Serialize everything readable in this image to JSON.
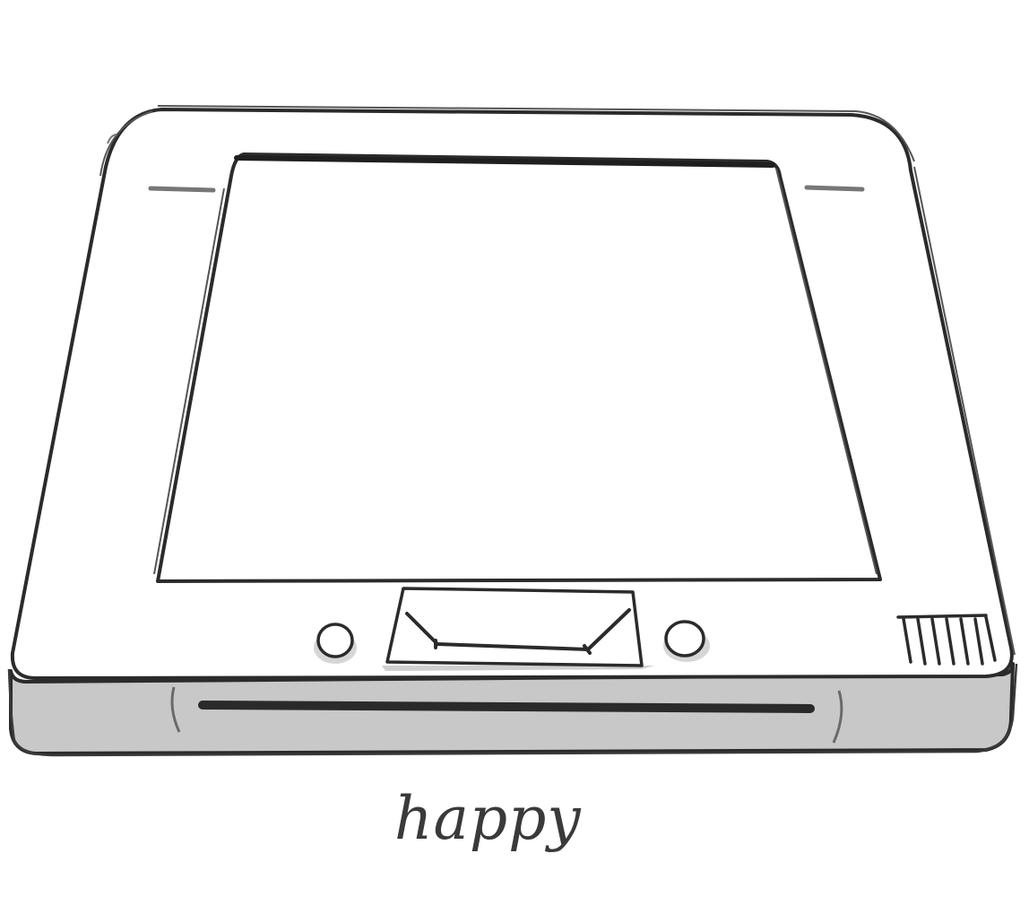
{
  "caption": "happy",
  "colors": {
    "ink": "#2b2b2b",
    "ink_light": "#4a4a4a",
    "body_fill": "#ffffff",
    "front_fill": "#c8c8c8",
    "shadow": "#d6d6d6"
  },
  "icons": {
    "device": "scanner-device-icon",
    "left_button": "round-button-icon",
    "right_button": "round-button-icon",
    "center_panel": "envelope-panel-icon",
    "vent": "vent-grille-icon",
    "slot": "paper-slot-icon"
  }
}
